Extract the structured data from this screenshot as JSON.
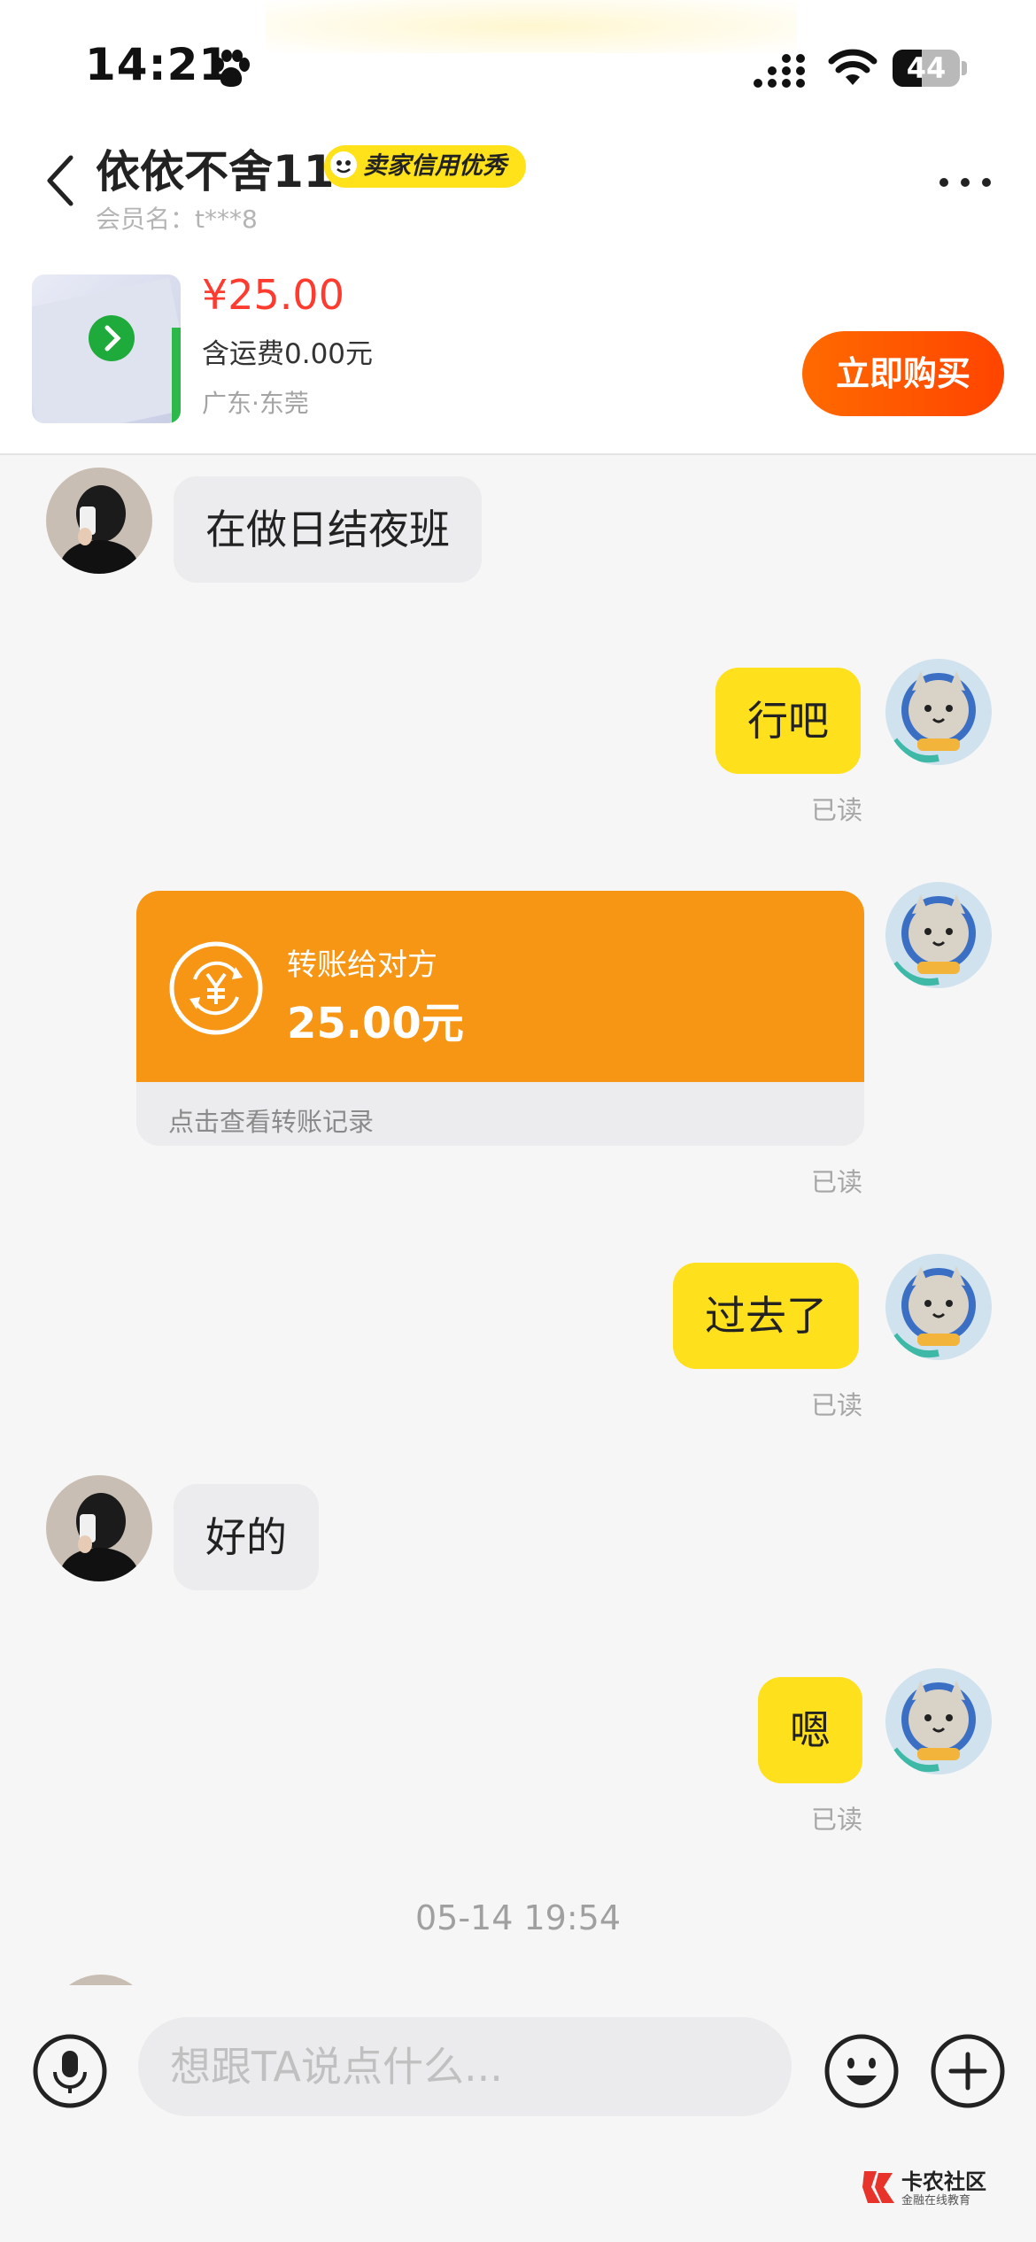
{
  "status_bar": {
    "time": "14:21",
    "battery": "44",
    "battery_level": 0.44
  },
  "header": {
    "title": "依依不舍11",
    "badge": "卖家信用优秀",
    "member": "会员名：t***8"
  },
  "product": {
    "price": "¥25.00",
    "shipping": "含运费0.00元",
    "location": "广东·东莞",
    "buy_label": "立即购买"
  },
  "messages": {
    "m1": "在做日结夜班",
    "m2": "行吧",
    "m2_read": "已读",
    "transfer": {
      "title": "转账给对方",
      "amount": "25.00元",
      "link": "点击查看转账记录",
      "read": "已读"
    },
    "m3": "过去了",
    "m3_read": "已读",
    "m4": "好的",
    "m5": "嗯",
    "m5_read": "已读",
    "timestamp": "05-14 19:54"
  },
  "input": {
    "placeholder": "想跟TA说点什么..."
  },
  "watermark": {
    "title": "卡农社区",
    "subtitle": "金融在线教育"
  },
  "colors": {
    "accent_yellow": "#ffe01c",
    "buy_orange": "#ff4400",
    "price_red": "#ff3b30",
    "transfer_orange": "#f79614"
  }
}
